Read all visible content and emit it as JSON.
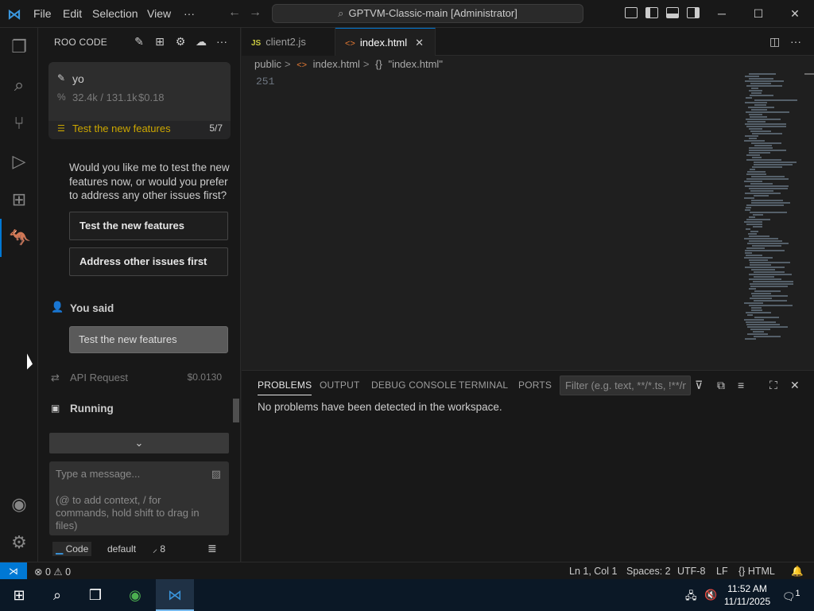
{
  "menu": {
    "file": "File",
    "edit": "Edit",
    "selection": "Selection",
    "view": "View",
    "more": "···"
  },
  "command_center": {
    "text": "GPTVM-Classic-main [Administrator]"
  },
  "sidebar": {
    "title": "ROO CODE",
    "task": {
      "title": "yo",
      "tokens": "32.4k / 131.1k",
      "cost": "$0.18"
    },
    "todo": {
      "label": "Test the new features",
      "count": "5/7"
    },
    "question": "Would you like me to test the new features now, or would you prefer to address any other issues first?",
    "suggestions": [
      "Test the new features",
      "Address other issues first"
    ],
    "you_said": "You said",
    "user_message": "Test the new features",
    "api_request": {
      "label": "API Request",
      "cost": "$0.0130"
    },
    "running": "Running",
    "input": {
      "placeholder": "Type a message...",
      "hint": "(@ to add context, / for commands, hold shift to drag in files)"
    },
    "footer": {
      "mode": "Code",
      "model": "default",
      "context": "8"
    }
  },
  "editor": {
    "tabs": [
      {
        "label": "client2.js",
        "icon": "js"
      },
      {
        "label": "index.html",
        "icon": "html"
      }
    ],
    "breadcrumb": [
      "public",
      "index.html",
      "\"index.html\""
    ],
    "line_number": "251"
  },
  "panel": {
    "tabs": [
      "PROBLEMS",
      "OUTPUT",
      "DEBUG CONSOLE",
      "TERMINAL",
      "PORTS"
    ],
    "filter_placeholder": "Filter (e.g. text, **/*.ts, !**/n...",
    "message": "No problems have been detected in the workspace."
  },
  "statusbar": {
    "errors": "0",
    "warnings": "0",
    "position": "Ln 1, Col 1",
    "spaces": "Spaces: 2",
    "encoding": "UTF-8",
    "eol": "LF",
    "language": "HTML"
  },
  "taskbar": {
    "time": "11:52 AM",
    "date": "11/11/2025",
    "notifications": "1"
  },
  "colors": {
    "accent": "#0078d4",
    "todo": "#cca700",
    "background": "#1f1f1f"
  }
}
